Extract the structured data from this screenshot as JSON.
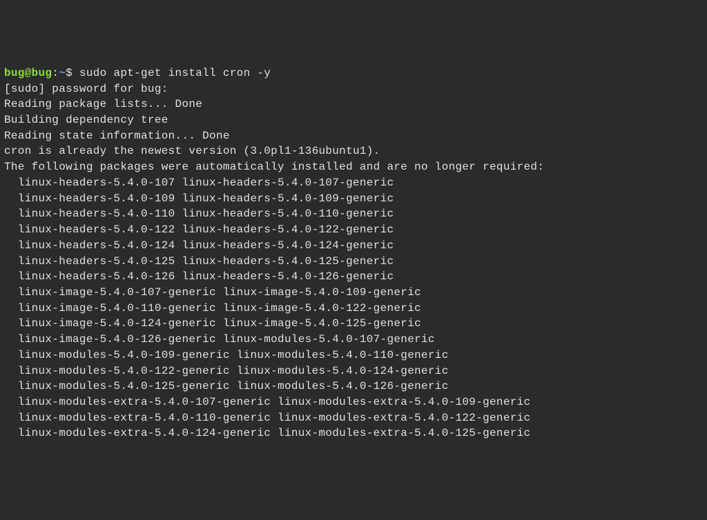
{
  "prompt": {
    "user_host": "bug@bug",
    "colon": ":",
    "path": "~",
    "dollar": "$ ",
    "command": "sudo apt-get install cron -y"
  },
  "lines": {
    "sudo_prompt": "[sudo] password for bug:",
    "reading_packages": "Reading package lists... Done",
    "building_tree": "Building dependency tree",
    "reading_state": "Reading state information... Done",
    "cron_newest": "cron is already the newest version (3.0pl1-136ubuntu1).",
    "auto_installed": "The following packages were automatically installed and are no longer required:",
    "pkg01": "  linux-headers-5.4.0-107 linux-headers-5.4.0-107-generic",
    "pkg02": "  linux-headers-5.4.0-109 linux-headers-5.4.0-109-generic",
    "pkg03": "  linux-headers-5.4.0-110 linux-headers-5.4.0-110-generic",
    "pkg04": "  linux-headers-5.4.0-122 linux-headers-5.4.0-122-generic",
    "pkg05": "  linux-headers-5.4.0-124 linux-headers-5.4.0-124-generic",
    "pkg06": "  linux-headers-5.4.0-125 linux-headers-5.4.0-125-generic",
    "pkg07": "  linux-headers-5.4.0-126 linux-headers-5.4.0-126-generic",
    "pkg08": "  linux-image-5.4.0-107-generic linux-image-5.4.0-109-generic",
    "pkg09": "  linux-image-5.4.0-110-generic linux-image-5.4.0-122-generic",
    "pkg10": "  linux-image-5.4.0-124-generic linux-image-5.4.0-125-generic",
    "pkg11": "  linux-image-5.4.0-126-generic linux-modules-5.4.0-107-generic",
    "pkg12": "  linux-modules-5.4.0-109-generic linux-modules-5.4.0-110-generic",
    "pkg13": "  linux-modules-5.4.0-122-generic linux-modules-5.4.0-124-generic",
    "pkg14": "  linux-modules-5.4.0-125-generic linux-modules-5.4.0-126-generic",
    "pkg15": "  linux-modules-extra-5.4.0-107-generic linux-modules-extra-5.4.0-109-generic",
    "pkg16": "  linux-modules-extra-5.4.0-110-generic linux-modules-extra-5.4.0-122-generic",
    "pkg17": "  linux-modules-extra-5.4.0-124-generic linux-modules-extra-5.4.0-125-generic"
  }
}
